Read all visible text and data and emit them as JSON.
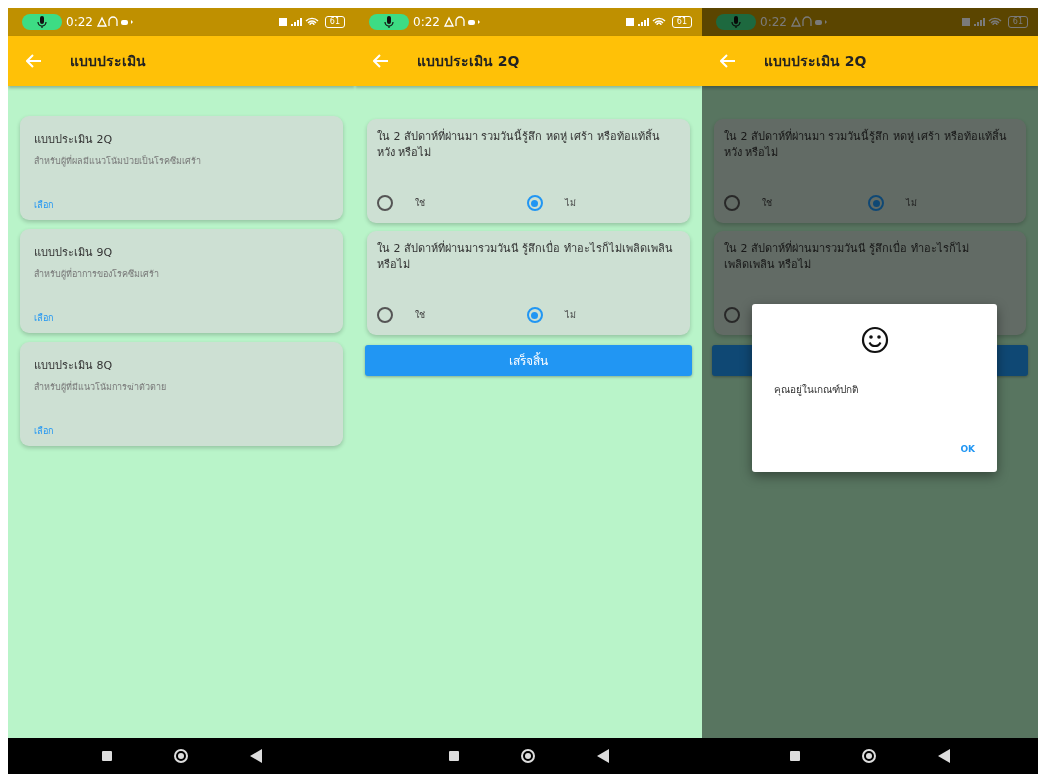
{
  "screens": [
    {
      "kind": "list",
      "status_bar": {
        "time": "0:22",
        "battery": "61"
      },
      "title": "แบบประเมิน",
      "items": [
        {
          "title": "แบบประเมิน 2Q",
          "subtitle": "สำหรับผู้ที่ผลมีแนวโน้มป่วยเป็นโรคซึมเศร้า",
          "action": "เลือก"
        },
        {
          "title": "แบบประเมิน 9Q",
          "subtitle": "สำหรับผู้ที่อาการของโรคซึมเศร้า",
          "action": "เลือก"
        },
        {
          "title": "แบบประเมิน 8Q",
          "subtitle": "สำหรับผู้ที่มีแนวโน้มการฆ่าตัวตาย",
          "action": "เลือก"
        }
      ]
    },
    {
      "kind": "quiz",
      "status_bar": {
        "time": "0:22",
        "battery": "61"
      },
      "title": "แบบประเมิน 2Q",
      "questions": [
        {
          "text": "ใน 2 สัปดาห์ที่ผ่านมา รวมวันนี้รู้สึก หดหู่ เศร้า หรือท้อแท้สิ้นหวัง หรือไม่",
          "options": [
            {
              "label": "ใช่",
              "selected": false
            },
            {
              "label": "ไม่",
              "selected": true
            }
          ]
        },
        {
          "text": "ใน 2 สัปดาห์ที่ผ่านมารวมวันนี รู้สึกเบื่อ ทำอะไรก็ไม่เพลิดเพลิน หรือไม่",
          "options": [
            {
              "label": "ใช่",
              "selected": false
            },
            {
              "label": "ไม่",
              "selected": true
            }
          ]
        }
      ],
      "submit": "เสร็จสิ้น"
    },
    {
      "kind": "quiz",
      "status_bar": {
        "time": "0:22",
        "battery": "61"
      },
      "title": "แบบประเมิน 2Q",
      "questions": [
        {
          "text": "ใน 2 สัปดาห์ที่ผ่านมา รวมวันนี้รู้สึก หดหู่ เศร้า หรือท้อแท้สิ้นหวัง หรือไม่",
          "options": [
            {
              "label": "ใช่",
              "selected": false
            },
            {
              "label": "ไม่",
              "selected": true
            }
          ]
        },
        {
          "text": "ใน 2 สัปดาห์ที่ผ่านมารวมวันนี รู้สึกเบื่อ ทำอะไรก็ไม่เพลิดเพลิน หรือไม่",
          "options": [
            {
              "selected": false
            }
          ]
        }
      ],
      "dialog": {
        "message": "คุณอยู่ในเกณฑ์ปกติ",
        "ok": "OK"
      }
    }
  ]
}
